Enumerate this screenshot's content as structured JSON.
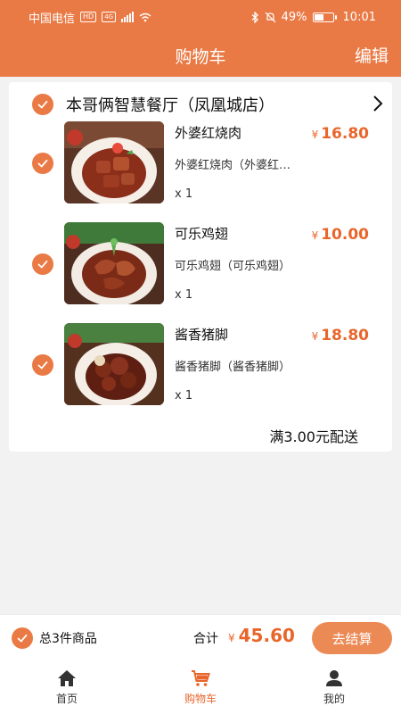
{
  "status": {
    "carrier": "中国电信",
    "net_badge": "HD",
    "net_type": "4G",
    "battery": "49%",
    "battery_level": 0.49,
    "time": "10:01"
  },
  "header": {
    "title": "购物车",
    "edit_label": "编辑"
  },
  "shop": {
    "name": "本哥俩智慧餐厅（凤凰城店）"
  },
  "items": [
    {
      "name": "外婆红烧肉",
      "currency": "¥",
      "price": "16.80",
      "desc": "外婆红烧肉（外婆红…",
      "qty": "x 1"
    },
    {
      "name": "可乐鸡翅",
      "currency": "¥",
      "price": "10.00",
      "desc": "可乐鸡翅（可乐鸡翅）",
      "qty": "x 1"
    },
    {
      "name": "酱香猪脚",
      "currency": "¥",
      "price": "18.80",
      "desc": "酱香猪脚（酱香猪脚）",
      "qty": "x 1"
    }
  ],
  "delivery_note": "满3.00元配送",
  "footer": {
    "total_count": "总3件商品",
    "sum_label": "合计",
    "currency": "¥",
    "sum_value": "45.60",
    "checkout_label": "去结算"
  },
  "tabs": [
    {
      "label": "首页",
      "icon": "home-icon"
    },
    {
      "label": "购物车",
      "icon": "cart-icon"
    },
    {
      "label": "我的",
      "icon": "user-icon"
    }
  ],
  "colors": {
    "accent": "#ea7a45",
    "price": "#e8662b",
    "button": "#ec8a55"
  }
}
